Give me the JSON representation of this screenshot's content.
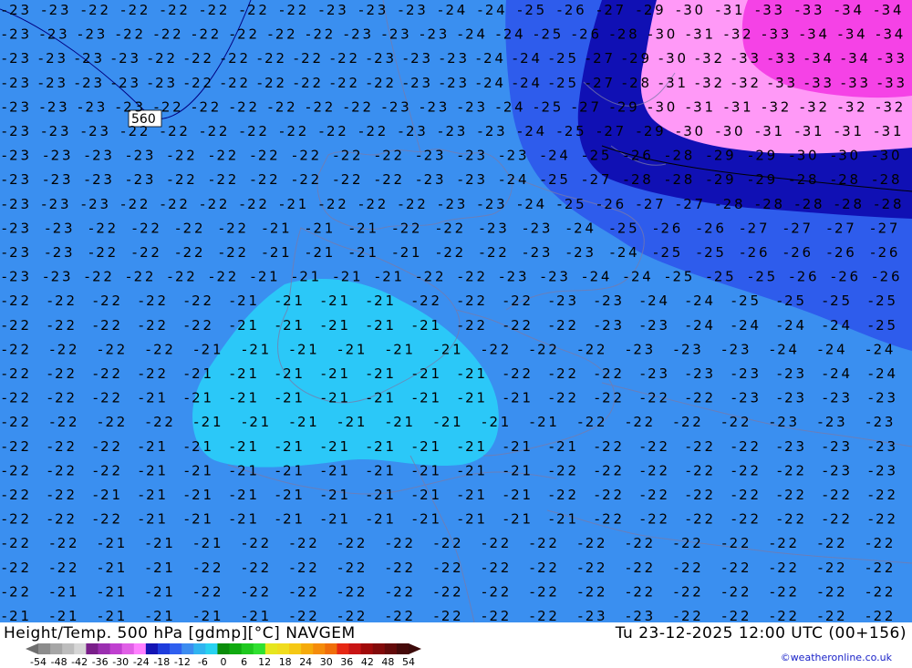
{
  "title": "Height/Temp. 500 hPa [gdmp][°C] NAVGEM",
  "valid_time": "Tu 23-12-2025 12:00 UTC (00+156)",
  "credit": "©weatheronline.co.uk",
  "height_contour_label": "560",
  "legend": {
    "ticks": [
      "-54",
      "-48",
      "-42",
      "-36",
      "-30",
      "-24",
      "-18",
      "-12",
      "-6",
      "0",
      "6",
      "12",
      "18",
      "24",
      "30",
      "36",
      "42",
      "48",
      "54"
    ],
    "colors": [
      "#8c8c8c",
      "#a6a6a6",
      "#bdbdbd",
      "#d6d6d6",
      "#7a1f8a",
      "#9b2fb0",
      "#c040d0",
      "#e060e6",
      "#ff80ff",
      "#1414b4",
      "#1e3cdc",
      "#2f5fef",
      "#3c8cf0",
      "#30b4f0",
      "#28d2f0",
      "#0a8c0a",
      "#10aa10",
      "#1ec81e",
      "#30e030",
      "#e6e61e",
      "#f0dc1e",
      "#f5c814",
      "#f5aa0a",
      "#f58c0a",
      "#f06e0a",
      "#e62814",
      "#c81414",
      "#a00a0a",
      "#820a0a",
      "#640a0a",
      "#460a0a"
    ]
  },
  "map": {
    "fill_colors": {
      "t_above_-22": "#2bc8f8",
      "t_-22_to_-26": "#3a8ff0",
      "t_-26_to_-28": "#2e5cec",
      "t_-28_to_-30": "#1010b4",
      "t_-30_to_-32": "#ff99f7",
      "t_below_-32": "#f542e6"
    },
    "temperature_labels": [
      {
        "text": "-23",
        "row": 0
      },
      {
        "text": "-22",
        "row": 0
      }
    ],
    "rows": [
      "-23 -23 -22 -22 -22 -22 -22 -22 -23 -23 -23 -24 -24 -25 -26 -27 -29 -30 -31 -33 -33 -34 -34",
      "-23 -23 -23 -22 -22 -22 -22 -22 -22 -23 -23 -23 -24 -24 -25 -26 -28 -30 -31 -32 -33 -34 -34 -34",
      "-23 -23 -23 -23 -22 -22 -22 -22 -22 -22 -23 -23 -23 -24 -24 -25 -27 -29 -30 -32 -33 -33 -34 -34 -33",
      "-23 -23 -23 -23 -23 -22 -22 -22 -22 -22 -22 -23 -23 -24 -24 -25 -27 -28 -31 -32 -32 -33 -33 -33 -33",
      "-23 -23 -23 -23 -22 -22 -22 -22 -22 -22 -23 -23 -23 -24 -25 -27 -29 -30 -31 -31 -32 -32 -32 -32",
      "-23 -23 -23 -22 -22 -22 -22 -22 -22 -22 -23 -23 -23 -24 -25 -27 -29 -30 -30 -31 -31 -31 -31",
      "-23 -23 -23 -23 -22 -22 -22 -22 -22 -22 -23 -23 -23 -24 -25 -26 -28 -29 -29 -30 -30 -30",
      "-23 -23 -23 -23 -22 -22 -22 -22 -22 -22 -23 -23 -24 -25 -27 -28 -28 -29 -29 -28 -28 -28",
      "-23 -23 -23 -22 -22 -22 -22 -21 -22 -22 -22 -23 -23 -24 -25 -26 -27 -27 -28 -28 -28 -28 -28",
      "-23 -23 -22 -22 -22 -22 -21 -21 -21 -22 -22 -23 -23 -24 -25 -26 -26 -27 -27 -27 -27",
      "-23 -23 -22 -22 -22 -22 -21 -21 -21 -21 -22 -22 -23 -23 -24 -25 -25 -26 -26 -26 -26",
      "-23 -23 -22 -22 -22 -22 -21 -21 -21 -21 -22 -22 -23 -23 -24 -24 -25 -25 -25 -26 -26 -26",
      "-22 -22 -22 -22 -22 -21 -21 -21 -21 -22 -22 -22 -23 -23 -24 -24 -25 -25 -25 -25",
      "-22 -22 -22 -22 -22 -21 -21 -21 -21 -21 -22 -22 -22 -23 -23 -24 -24 -24 -24 -25",
      "-22 -22 -22 -22 -21 -21 -21 -21 -21 -21 -22 -22 -22 -23 -23 -23 -24 -24 -24",
      "-22 -22 -22 -22 -21 -21 -21 -21 -21 -21 -21 -22 -22 -22 -23 -23 -23 -23 -24 -24",
      "-22 -22 -22 -21 -21 -21 -21 -21 -21 -21 -21 -21 -22 -22 -22 -22 -23 -23 -23 -23",
      "-22 -22 -22 -22 -21 -21 -21 -21 -21 -21 -21 -21 -22 -22 -22 -22 -23 -23 -23",
      "-22 -22 -22 -21 -21 -21 -21 -21 -21 -21 -21 -21 -21 -22 -22 -22 -22 -23 -23 -23",
      "-22 -22 -22 -21 -21 -21 -21 -21 -21 -21 -21 -21 -22 -22 -22 -22 -22 -22 -23 -23",
      "-22 -22 -21 -21 -21 -21 -21 -21 -21 -21 -21 -21 -22 -22 -22 -22 -22 -22 -22 -22",
      "-22 -22 -22 -21 -21 -21 -21 -21 -21 -21 -21 -21 -21 -22 -22 -22 -22 -22 -22 -22",
      "-22 -22 -21 -21 -21 -22 -22 -22 -22 -22 -22 -22 -22 -22 -22 -22 -22 -22 -22",
      "-22 -22 -21 -21 -22 -22 -22 -22 -22 -22 -22 -22 -22 -22 -22 -22 -22 -22 -22",
      "-22 -21 -21 -21 -22 -22 -22 -22 -22 -22 -22 -22 -22 -22 -22 -22 -22 -22 -22",
      "-21 -21 -21 -21 -21 -21 -22 -22 -22 -22 -22 -22 -23 -23 -22 -22 -22 -22 -22"
    ]
  }
}
